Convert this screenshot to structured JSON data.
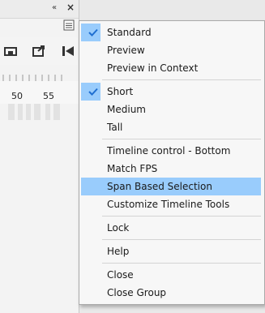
{
  "menu": {
    "items": [
      {
        "label": "Standard",
        "checked": true
      },
      {
        "label": "Preview",
        "checked": false
      },
      {
        "label": "Preview in Context",
        "checked": false
      },
      {
        "label": "Short",
        "checked": true
      },
      {
        "label": "Medium",
        "checked": false
      },
      {
        "label": "Tall",
        "checked": false
      },
      {
        "label": "Timeline control - Bottom",
        "checked": false
      },
      {
        "label": "Match FPS",
        "checked": false
      },
      {
        "label": "Span Based Selection",
        "highlighted": true
      },
      {
        "label": "Customize Timeline Tools"
      },
      {
        "label": "Lock"
      },
      {
        "label": "Help"
      },
      {
        "label": "Close"
      },
      {
        "label": "Close Group"
      }
    ],
    "highlight_color": "#99ccfc",
    "check_color": "#1f6fd1"
  },
  "panel": {
    "collapse_icon": "double-chevron-left-icon",
    "close_icon": "close-icon",
    "options_icon": "panel-options-icon",
    "ruler_labels": [
      "50",
      "55"
    ]
  }
}
